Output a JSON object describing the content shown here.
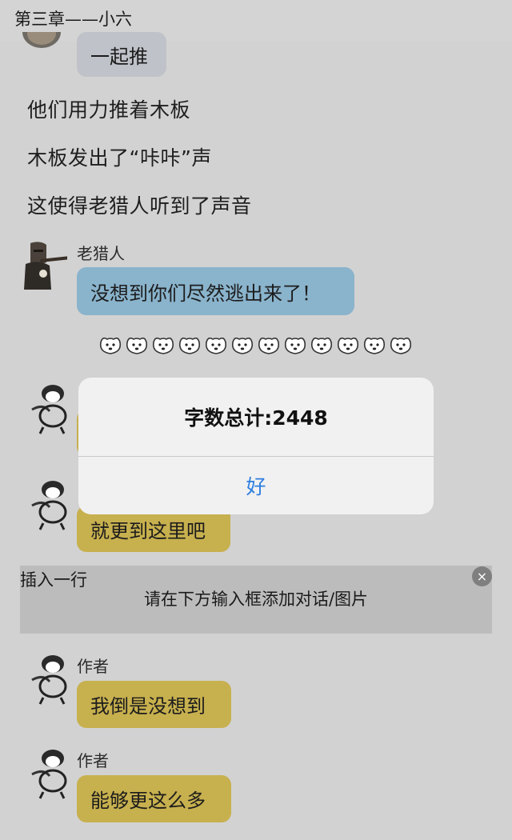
{
  "header": {
    "title": "第三章——小六"
  },
  "messages": {
    "top_bubble": "一起推",
    "narration1": "他们用力推着木板",
    "narration2": "木板发出了“咔咔”声",
    "narration3": "这使得老猎人听到了声音",
    "hunter_name": "老猎人",
    "hunter_text": "没想到你们尽然逃出来了！",
    "hidden1_text": "",
    "hidden2_text": "就更到这里吧",
    "author1_name": "作者",
    "author1_text": "我倒是没想到",
    "author2_name": "作者",
    "author2_text": "能够更这么多"
  },
  "divider": {
    "count": 12
  },
  "dialog": {
    "message": "字数总计:2448",
    "ok_label": "好"
  },
  "insert": {
    "title": "插入一行",
    "hint": "请在下方输入框添加对话/图片",
    "close_icon": "×"
  },
  "colors": {
    "background": "#d2d2d2",
    "bubble_gray": "#bfc2c8",
    "bubble_blue": "#8ab3cc",
    "bubble_gold": "#c7b04e",
    "dialog_button": "#2f7fe0"
  }
}
